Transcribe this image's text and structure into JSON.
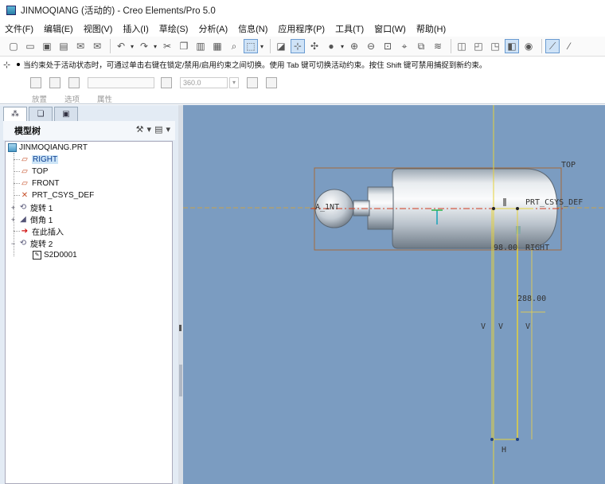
{
  "window": {
    "title": "JINMOQIANG (活动的) - Creo Elements/Pro 5.0"
  },
  "menu": [
    "文件(F)",
    "编辑(E)",
    "视图(V)",
    "插入(I)",
    "草绘(S)",
    "分析(A)",
    "信息(N)",
    "应用程序(P)",
    "工具(T)",
    "窗口(W)",
    "帮助(H)"
  ],
  "toolbar": {
    "icons": [
      "new-file-icon",
      "open-file-icon",
      "save-icon",
      "print-icon",
      "email-icon",
      "email-link-icon",
      "undo-icon",
      "redo-icon",
      "cut-icon",
      "copy-icon",
      "paste-icon",
      "paste-special-icon",
      "find-icon",
      "select-box-icon",
      "sketch-icon",
      "constraint-icon",
      "datum-icon",
      "shading-icon",
      "zoom-in-icon",
      "zoom-out-icon",
      "refit-icon",
      "orient-icon",
      "view-manager-icon",
      "layers-icon",
      "wireframe-icon",
      "hidden-line-icon",
      "no-hidden-icon",
      "shaded-icon",
      "display-style-icon",
      "datum-plane-icon",
      "datum-axis-icon"
    ]
  },
  "dashboard": {
    "message": "当约束处于活动状态时，可通过单击右键在锁定/禁用/启用约束之间切换。使用 Tab 键可切换活动约束。按住 Shift 键可禁用捕捉到新约束。",
    "angle_value": "360.0",
    "tabs": [
      "放置",
      "选项",
      "属性"
    ]
  },
  "model_tree": {
    "title": "模型树",
    "items": [
      {
        "label": "JINMOQIANG.PRT",
        "icon": "part-icon"
      },
      {
        "label": "RIGHT",
        "icon": "datum-plane-icon",
        "selected": true
      },
      {
        "label": "TOP",
        "icon": "datum-plane-icon"
      },
      {
        "label": "FRONT",
        "icon": "datum-plane-icon"
      },
      {
        "label": "PRT_CSYS_DEF",
        "icon": "csys-icon"
      },
      {
        "label": "旋转 1",
        "icon": "revolve-icon",
        "expand": "+"
      },
      {
        "label": "倒角 1",
        "icon": "chamfer-icon",
        "expand": "+"
      },
      {
        "label": "在此插入",
        "icon": "insert-here-icon"
      },
      {
        "label": "旋转 2",
        "icon": "revolve-icon",
        "expand": "−"
      },
      {
        "label": "S2D0001",
        "icon": "sketch-icon"
      }
    ]
  },
  "viewport": {
    "background": "#7b9cc1",
    "labels": {
      "top": "TOP",
      "csys": "PRT_CSYS_DEF",
      "axis": "A_1NT",
      "dim_diameter": "98.00",
      "dim_right": "RIGHT",
      "dim_length": "288.00",
      "v": "V",
      "h": "H"
    }
  }
}
